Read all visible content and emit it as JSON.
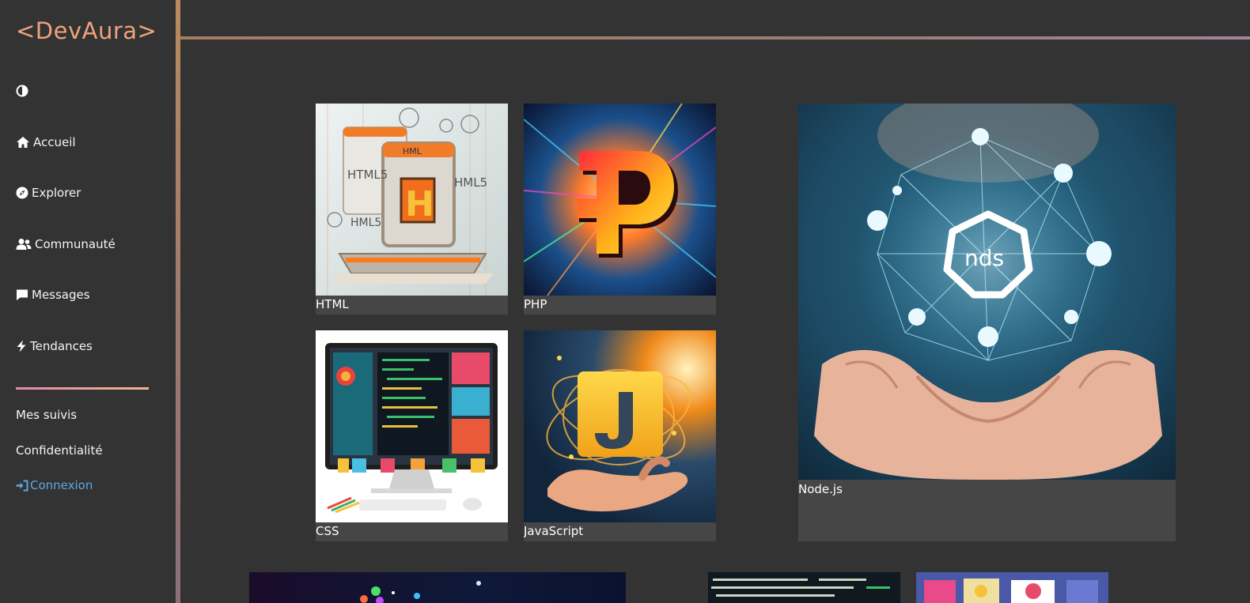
{
  "brand": {
    "logo": "<DevAura>",
    "accent": "#f0a27c"
  },
  "nav": {
    "theme_icon": "contrast-icon",
    "items": [
      {
        "label": "Accueil",
        "icon": "home-icon"
      },
      {
        "label": "Explorer",
        "icon": "compass-icon"
      },
      {
        "label": "Communauté",
        "icon": "users-icon"
      },
      {
        "label": "Messages",
        "icon": "message-icon"
      },
      {
        "label": "Tendances",
        "icon": "bolt-icon"
      }
    ],
    "secondary": [
      {
        "label": "Mes suivis"
      },
      {
        "label": "Confidentialité"
      }
    ],
    "login": {
      "label": "Connexion",
      "icon": "sign-in-icon",
      "color": "#5da7e3"
    }
  },
  "cards": [
    {
      "label": "HTML"
    },
    {
      "label": "PHP"
    },
    {
      "label": "CSS"
    },
    {
      "label": "JavaScript"
    },
    {
      "label": "Node.js"
    }
  ]
}
